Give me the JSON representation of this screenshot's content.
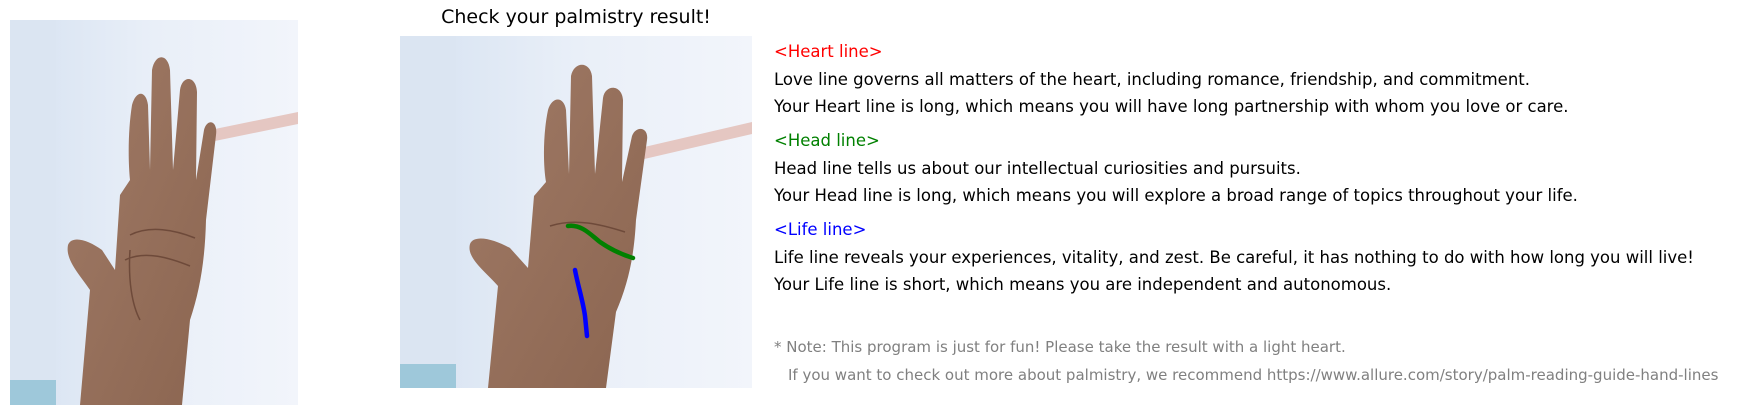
{
  "title": "Check your palmistry result!",
  "colors": {
    "heart": "#ff0000",
    "head": "#008000",
    "life": "#0000ff",
    "note": "#808080"
  },
  "sections": [
    {
      "heading": "<Heart line>",
      "description": "Love line governs all matters of the heart, including romance, friendship, and commitment.",
      "result": "Your Heart line is long, which means you will have long partnership with whom you love or care."
    },
    {
      "heading": "<Head line>",
      "description": "Head line tells us about our intellectual curiosities and pursuits.",
      "result": "Your Head line is long, which means you will explore a broad range of topics throughout your life."
    },
    {
      "heading": "<Life line>",
      "description": "Life line reveals your experiences, vitality, and zest. Be careful, it has nothing to do with how long you will live!",
      "result": "Your Life line is short, which means you are independent and autonomous."
    }
  ],
  "note": {
    "line1": "* Note: This program is just for fun! Please take the result with a light heart.",
    "line2": "If you want to check out more about palmistry, we recommend https://www.allure.com/story/palm-reading-guide-hand-lines"
  }
}
